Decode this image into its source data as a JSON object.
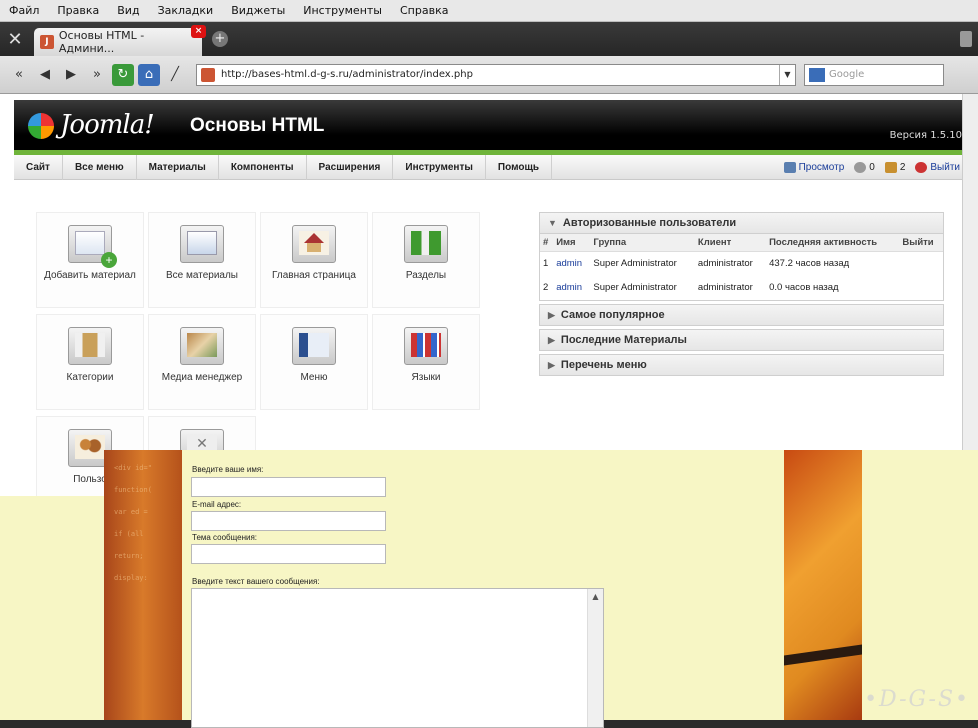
{
  "browser": {
    "menu": [
      "Файл",
      "Правка",
      "Вид",
      "Закладки",
      "Виджеты",
      "Инструменты",
      "Справка"
    ],
    "tab_title": "Основы HTML - Админи...",
    "url": "http://bases-html.d-g-s.ru/administrator/index.php",
    "search_placeholder": "Google"
  },
  "joomla": {
    "logo": "Joomla!",
    "site_name": "Основы HTML",
    "version": "Версия 1.5.10",
    "menu": [
      "Сайт",
      "Все меню",
      "Материалы",
      "Компоненты",
      "Расширения",
      "Инструменты",
      "Помощь"
    ],
    "preview": "Просмотр",
    "messages_count": "0",
    "users_count": "2",
    "logout": "Выйти",
    "cpanel": [
      {
        "label": "Добавить материал",
        "icon": "add-article-icon"
      },
      {
        "label": "Все материалы",
        "icon": "articles-icon"
      },
      {
        "label": "Главная страница",
        "icon": "frontpage-icon"
      },
      {
        "label": "Разделы",
        "icon": "sections-icon"
      },
      {
        "label": "Категории",
        "icon": "categories-icon"
      },
      {
        "label": "Медиа менеджер",
        "icon": "media-manager-icon"
      },
      {
        "label": "Меню",
        "icon": "menu-icon"
      },
      {
        "label": "Языки",
        "icon": "languages-icon"
      },
      {
        "label": "Пользо",
        "icon": "users-icon"
      },
      {
        "label": "",
        "icon": "config-icon"
      }
    ],
    "modules": {
      "logged_title": "Авторизованные пользователи",
      "logged_headers": [
        "#",
        "Имя",
        "Группа",
        "Клиент",
        "Последняя активность",
        "Выйти"
      ],
      "logged_rows": [
        [
          "1",
          "admin",
          "Super Administrator",
          "administrator",
          "437.2 часов назад",
          ""
        ],
        [
          "2",
          "admin",
          "Super Administrator",
          "administrator",
          "0.0 часов назад",
          ""
        ]
      ],
      "popular": "Самое популярное",
      "latest": "Последние Материалы",
      "menu_stats": "Перечень меню"
    }
  },
  "form": {
    "name_label": "Введите ваше имя:",
    "email_label": "E-mail адрес:",
    "subject_label": "Тема сообщения:",
    "message_label": "Введите текст вашего сообщения:"
  },
  "watermark": "•D-G-S•"
}
